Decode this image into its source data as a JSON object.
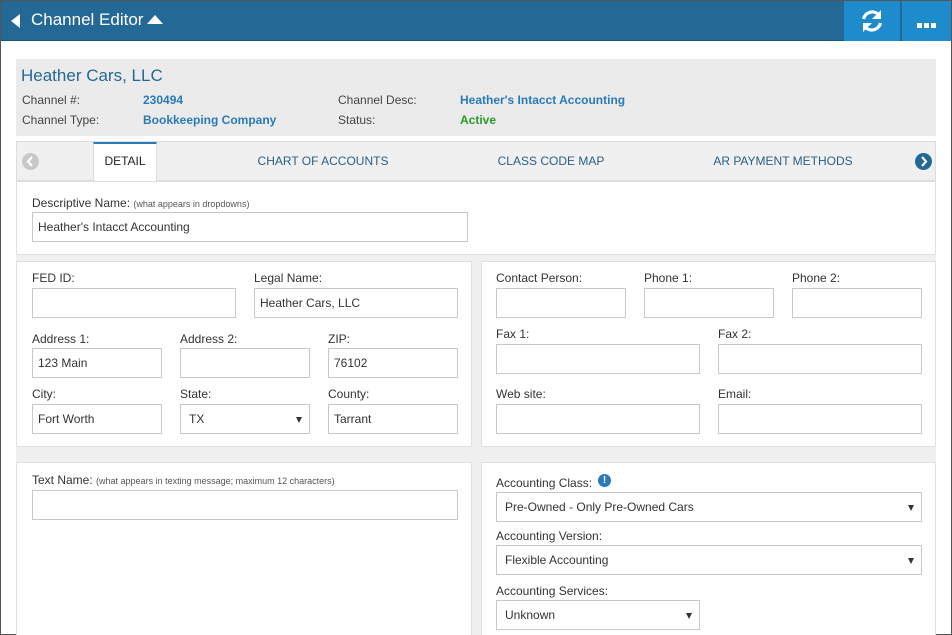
{
  "topbar": {
    "title": "Channel Editor",
    "refresh_icon": "refresh-icon",
    "more_icon": "more-dots-icon"
  },
  "header": {
    "name": "Heather Cars, LLC",
    "channel_num_label": "Channel #:",
    "channel_num": "230494",
    "channel_type_label": "Channel Type:",
    "channel_type": "Bookkeeping Company",
    "channel_desc_label": "Channel Desc:",
    "channel_desc": "Heather's Intacct Accounting",
    "status_label": "Status:",
    "status": "Active",
    "colors": {
      "link": "#2a7ab8",
      "status": "#2a9b2a"
    }
  },
  "tabs": [
    "DETAIL",
    "CHART OF ACCOUNTS",
    "CLASS CODE MAP",
    "AR PAYMENT METHODS"
  ],
  "form": {
    "descriptive_name_label": "Descriptive Name:",
    "descriptive_name_hint": "(what appears in dropdowns)",
    "descriptive_name": "Heather's Intacct Accounting",
    "fed_id_label": "FED ID:",
    "fed_id": "",
    "legal_name_label": "Legal Name:",
    "legal_name": "Heather Cars, LLC",
    "address1_label": "Address 1:",
    "address1": "123 Main",
    "address2_label": "Address 2:",
    "address2": "",
    "zip_label": "ZIP:",
    "zip": "76102",
    "city_label": "City:",
    "city": "Fort Worth",
    "state_label": "State:",
    "state": "TX",
    "county_label": "County:",
    "county": "Tarrant",
    "contact_label": "Contact Person:",
    "contact": "",
    "phone1_label": "Phone 1:",
    "phone1": "",
    "phone2_label": "Phone 2:",
    "phone2": "",
    "fax1_label": "Fax 1:",
    "fax1": "",
    "fax2_label": "Fax 2:",
    "fax2": "",
    "website_label": "Web site:",
    "website": "",
    "email_label": "Email:",
    "email": "",
    "text_name_label": "Text Name:",
    "text_name_hint": "(what appears in texting message; maximum 12 characters)",
    "text_name": "",
    "accounting_class_label": "Accounting Class:",
    "accounting_class": "Pre-Owned - Only Pre-Owned Cars",
    "accounting_version_label": "Accounting Version:",
    "accounting_version": "Flexible Accounting",
    "accounting_services_label": "Accounting Services:",
    "accounting_services": "Unknown"
  }
}
